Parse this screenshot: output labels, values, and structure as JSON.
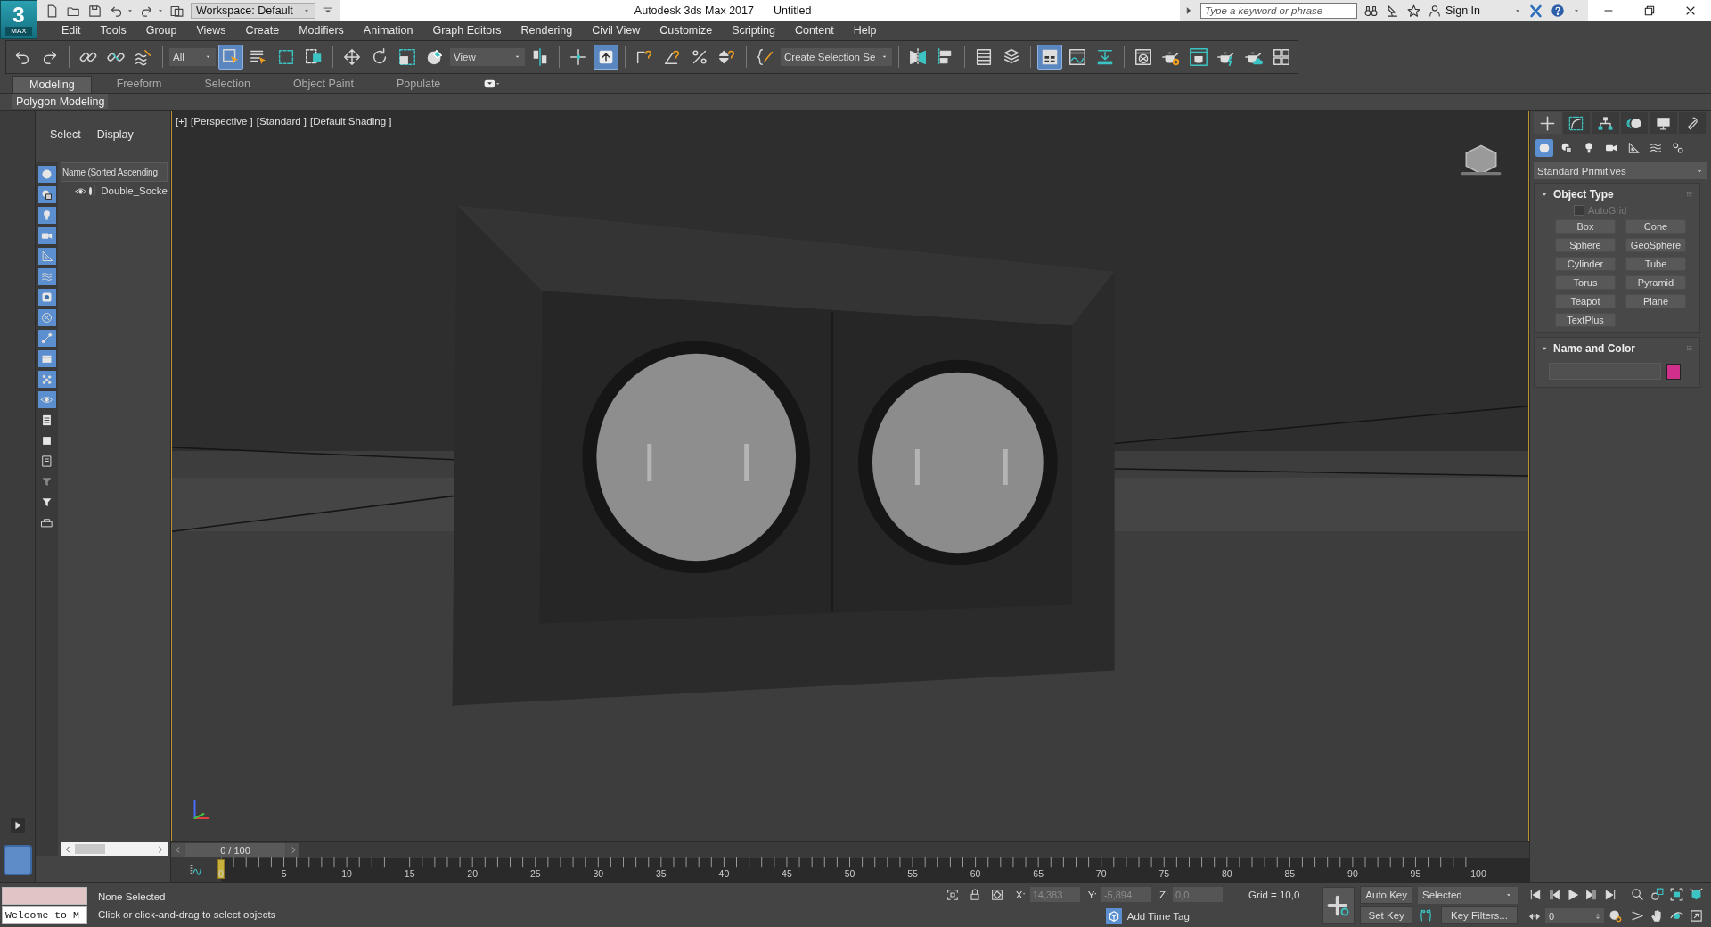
{
  "logo": {
    "mark": "3",
    "label": "MAX"
  },
  "title_bar": {
    "workspace": "Workspace: Default",
    "app_title": "Autodesk 3ds Max 2017",
    "document": "Untitled",
    "search": {
      "placeholder": "Type a keyword or phrase"
    },
    "sign_in": "Sign In"
  },
  "menu": [
    "Edit",
    "Tools",
    "Group",
    "Views",
    "Create",
    "Modifiers",
    "Animation",
    "Graph Editors",
    "Rendering",
    "Civil View",
    "Customize",
    "Scripting",
    "Content",
    "Help"
  ],
  "main_toolbar": {
    "selection_filter": "All",
    "reference_coordinate": "View",
    "named_selection": "Create Selection Se",
    "buttons": [
      {
        "selected": false
      },
      {
        "selected": false
      },
      {
        "selected": false
      },
      {
        "selected": false
      },
      {
        "selected": false
      },
      {
        "selected": true
      },
      {
        "selected": false
      },
      {
        "selected": false
      },
      {
        "selected": false
      },
      {
        "selected": false
      },
      {
        "selected": false
      },
      {
        "selected": false
      },
      {
        "selected": false
      },
      {
        "selected": false
      },
      {
        "selected": false
      },
      {
        "selected": true
      },
      {
        "selected": false
      },
      {
        "selected": false
      },
      {
        "selected": false
      },
      {
        "selected": false
      },
      {
        "selected": false
      },
      {
        "selected": false
      },
      {
        "selected": false
      },
      {
        "selected": false
      },
      {
        "selected": false
      },
      {
        "selected": true
      },
      {
        "selected": false
      },
      {
        "selected": false
      },
      {
        "selected": false
      },
      {
        "selected": false
      },
      {
        "selected": false
      },
      {
        "selected": false
      },
      {
        "selected": false
      },
      {
        "selected": false
      }
    ]
  },
  "ribbon": {
    "tabs": [
      {
        "label": "Modeling",
        "selected": true
      },
      {
        "label": "Freeform",
        "selected": false
      },
      {
        "label": "Selection",
        "selected": false
      },
      {
        "label": "Object Paint",
        "selected": false
      },
      {
        "label": "Populate",
        "selected": false
      }
    ],
    "panel": "Polygon Modeling"
  },
  "scene_explorer": {
    "tabs": [
      "Select",
      "Display"
    ],
    "filters": [
      {
        "on": true
      },
      {
        "on": true
      },
      {
        "on": true
      },
      {
        "on": true
      },
      {
        "on": true
      },
      {
        "on": true
      },
      {
        "on": true
      },
      {
        "on": true
      },
      {
        "on": true
      },
      {
        "on": true
      },
      {
        "on": true
      },
      {
        "on": true
      },
      {
        "on": false
      },
      {
        "on": false
      },
      {
        "on": false
      },
      {
        "on": false
      },
      {
        "on": false
      },
      {
        "on": false
      }
    ],
    "column": "Name (Sorted Ascending",
    "rows": [
      {
        "name": "Double_Socke"
      }
    ]
  },
  "viewport": {
    "labels": [
      "[+]",
      "[Perspective ]",
      "[Standard ]",
      "[Default Shading ]"
    ]
  },
  "command_panel": {
    "tabs": [
      {
        "selected": true
      },
      {
        "selected": false
      },
      {
        "selected": false
      },
      {
        "selected": false
      },
      {
        "selected": false
      },
      {
        "selected": false
      }
    ],
    "categories": [
      {
        "selected": true
      },
      {
        "selected": false
      },
      {
        "selected": false
      },
      {
        "selected": false
      },
      {
        "selected": false
      },
      {
        "selected": false
      },
      {
        "selected": false
      }
    ],
    "dropdown": "Standard Primitives",
    "rollouts": [
      {
        "kind": "object_type",
        "title": "Object Type",
        "expanded": true,
        "autogrid": {
          "label": "AutoGrid",
          "checked": false,
          "disabled": true
        },
        "buttons": [
          "Box",
          "Cone",
          "Sphere",
          "GeoSphere",
          "Cylinder",
          "Tube",
          "Torus",
          "Pyramid",
          "Teapot",
          "Plane",
          "TextPlus"
        ]
      },
      {
        "kind": "name_color",
        "title": "Name and Color",
        "expanded": true,
        "color": "#d0308c"
      }
    ]
  },
  "time_slider": {
    "label": "0 / 100",
    "level": 0
  },
  "track_bar": {
    "labels": [
      "0",
      "5",
      "10",
      "15",
      "20",
      "25",
      "30",
      "35",
      "40",
      "45",
      "50",
      "55",
      "60",
      "65",
      "70",
      "75",
      "80",
      "85",
      "90",
      "95",
      "100"
    ]
  },
  "status_bar": {
    "listener_output": "Welcome to M",
    "selection": "None Selected",
    "prompt": "Click or click-and-drag to select objects",
    "coordinates": [
      {
        "axis": "X:",
        "value": "14,383"
      },
      {
        "axis": "Y:",
        "value": "-5,894"
      },
      {
        "axis": "Z:",
        "value": "0,0"
      }
    ],
    "grid": "Grid = 10,0",
    "time_tag": "Add Time Tag",
    "auto_key": "Auto Key",
    "key_set": "Selected",
    "set_key": "Set Key",
    "key_filters": "Key Filters...",
    "frame": "0"
  }
}
